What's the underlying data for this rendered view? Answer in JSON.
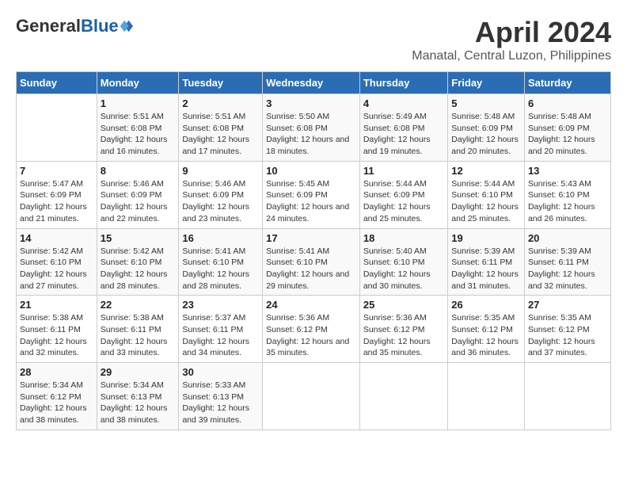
{
  "header": {
    "logo_general": "General",
    "logo_blue": "Blue",
    "main_title": "April 2024",
    "subtitle": "Manatal, Central Luzon, Philippines"
  },
  "calendar": {
    "days_of_week": [
      "Sunday",
      "Monday",
      "Tuesday",
      "Wednesday",
      "Thursday",
      "Friday",
      "Saturday"
    ],
    "weeks": [
      [
        {
          "day": "",
          "info": ""
        },
        {
          "day": "1",
          "info": "Sunrise: 5:51 AM\nSunset: 6:08 PM\nDaylight: 12 hours\nand 16 minutes."
        },
        {
          "day": "2",
          "info": "Sunrise: 5:51 AM\nSunset: 6:08 PM\nDaylight: 12 hours\nand 17 minutes."
        },
        {
          "day": "3",
          "info": "Sunrise: 5:50 AM\nSunset: 6:08 PM\nDaylight: 12 hours\nand 18 minutes."
        },
        {
          "day": "4",
          "info": "Sunrise: 5:49 AM\nSunset: 6:08 PM\nDaylight: 12 hours\nand 19 minutes."
        },
        {
          "day": "5",
          "info": "Sunrise: 5:48 AM\nSunset: 6:09 PM\nDaylight: 12 hours\nand 20 minutes."
        },
        {
          "day": "6",
          "info": "Sunrise: 5:48 AM\nSunset: 6:09 PM\nDaylight: 12 hours\nand 20 minutes."
        }
      ],
      [
        {
          "day": "7",
          "info": "Sunrise: 5:47 AM\nSunset: 6:09 PM\nDaylight: 12 hours\nand 21 minutes."
        },
        {
          "day": "8",
          "info": "Sunrise: 5:46 AM\nSunset: 6:09 PM\nDaylight: 12 hours\nand 22 minutes."
        },
        {
          "day": "9",
          "info": "Sunrise: 5:46 AM\nSunset: 6:09 PM\nDaylight: 12 hours\nand 23 minutes."
        },
        {
          "day": "10",
          "info": "Sunrise: 5:45 AM\nSunset: 6:09 PM\nDaylight: 12 hours\nand 24 minutes."
        },
        {
          "day": "11",
          "info": "Sunrise: 5:44 AM\nSunset: 6:09 PM\nDaylight: 12 hours\nand 25 minutes."
        },
        {
          "day": "12",
          "info": "Sunrise: 5:44 AM\nSunset: 6:10 PM\nDaylight: 12 hours\nand 25 minutes."
        },
        {
          "day": "13",
          "info": "Sunrise: 5:43 AM\nSunset: 6:10 PM\nDaylight: 12 hours\nand 26 minutes."
        }
      ],
      [
        {
          "day": "14",
          "info": "Sunrise: 5:42 AM\nSunset: 6:10 PM\nDaylight: 12 hours\nand 27 minutes."
        },
        {
          "day": "15",
          "info": "Sunrise: 5:42 AM\nSunset: 6:10 PM\nDaylight: 12 hours\nand 28 minutes."
        },
        {
          "day": "16",
          "info": "Sunrise: 5:41 AM\nSunset: 6:10 PM\nDaylight: 12 hours\nand 28 minutes."
        },
        {
          "day": "17",
          "info": "Sunrise: 5:41 AM\nSunset: 6:10 PM\nDaylight: 12 hours\nand 29 minutes."
        },
        {
          "day": "18",
          "info": "Sunrise: 5:40 AM\nSunset: 6:10 PM\nDaylight: 12 hours\nand 30 minutes."
        },
        {
          "day": "19",
          "info": "Sunrise: 5:39 AM\nSunset: 6:11 PM\nDaylight: 12 hours\nand 31 minutes."
        },
        {
          "day": "20",
          "info": "Sunrise: 5:39 AM\nSunset: 6:11 PM\nDaylight: 12 hours\nand 32 minutes."
        }
      ],
      [
        {
          "day": "21",
          "info": "Sunrise: 5:38 AM\nSunset: 6:11 PM\nDaylight: 12 hours\nand 32 minutes."
        },
        {
          "day": "22",
          "info": "Sunrise: 5:38 AM\nSunset: 6:11 PM\nDaylight: 12 hours\nand 33 minutes."
        },
        {
          "day": "23",
          "info": "Sunrise: 5:37 AM\nSunset: 6:11 PM\nDaylight: 12 hours\nand 34 minutes."
        },
        {
          "day": "24",
          "info": "Sunrise: 5:36 AM\nSunset: 6:12 PM\nDaylight: 12 hours\nand 35 minutes."
        },
        {
          "day": "25",
          "info": "Sunrise: 5:36 AM\nSunset: 6:12 PM\nDaylight: 12 hours\nand 35 minutes."
        },
        {
          "day": "26",
          "info": "Sunrise: 5:35 AM\nSunset: 6:12 PM\nDaylight: 12 hours\nand 36 minutes."
        },
        {
          "day": "27",
          "info": "Sunrise: 5:35 AM\nSunset: 6:12 PM\nDaylight: 12 hours\nand 37 minutes."
        }
      ],
      [
        {
          "day": "28",
          "info": "Sunrise: 5:34 AM\nSunset: 6:12 PM\nDaylight: 12 hours\nand 38 minutes."
        },
        {
          "day": "29",
          "info": "Sunrise: 5:34 AM\nSunset: 6:13 PM\nDaylight: 12 hours\nand 38 minutes."
        },
        {
          "day": "30",
          "info": "Sunrise: 5:33 AM\nSunset: 6:13 PM\nDaylight: 12 hours\nand 39 minutes."
        },
        {
          "day": "",
          "info": ""
        },
        {
          "day": "",
          "info": ""
        },
        {
          "day": "",
          "info": ""
        },
        {
          "day": "",
          "info": ""
        }
      ]
    ]
  }
}
